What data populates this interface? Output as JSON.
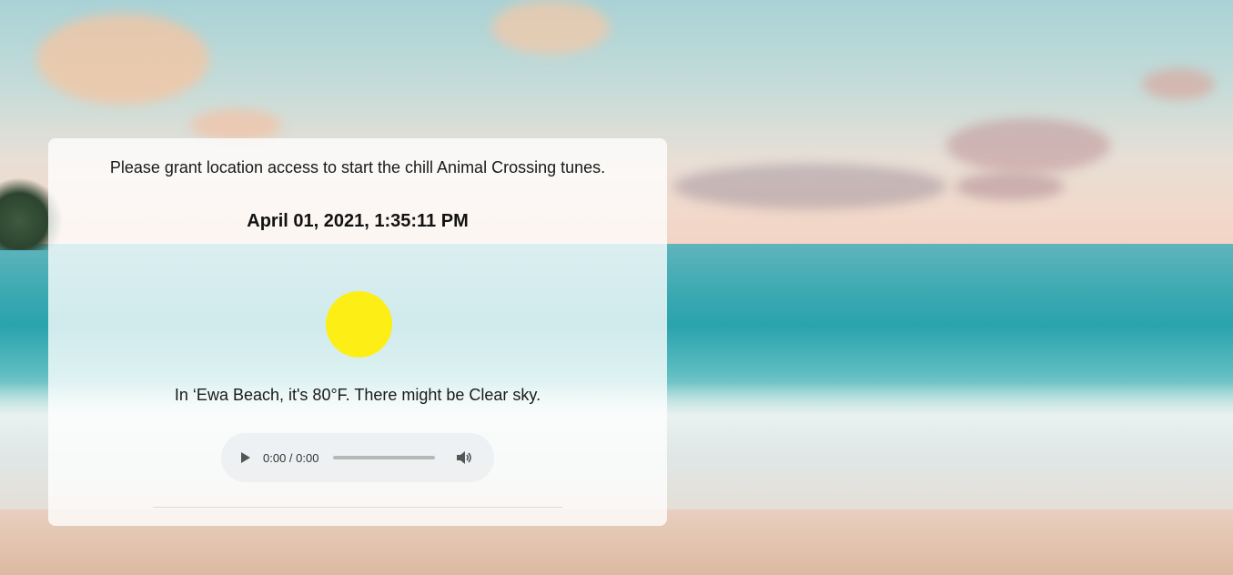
{
  "prompt": {
    "text": "Please grant location access to start the chill Animal Crossing tunes."
  },
  "clock": {
    "datetime": "April 01, 2021, 1:35:11 PM"
  },
  "weather": {
    "icon": "sun-icon",
    "sun_color": "#fdee15",
    "text": "In ‘Ewa Beach, it's 80°F. There might be Clear sky."
  },
  "player": {
    "time": "0:00 / 0:00",
    "progress": 0,
    "play_icon": "play-icon",
    "volume_icon": "volume-icon"
  }
}
